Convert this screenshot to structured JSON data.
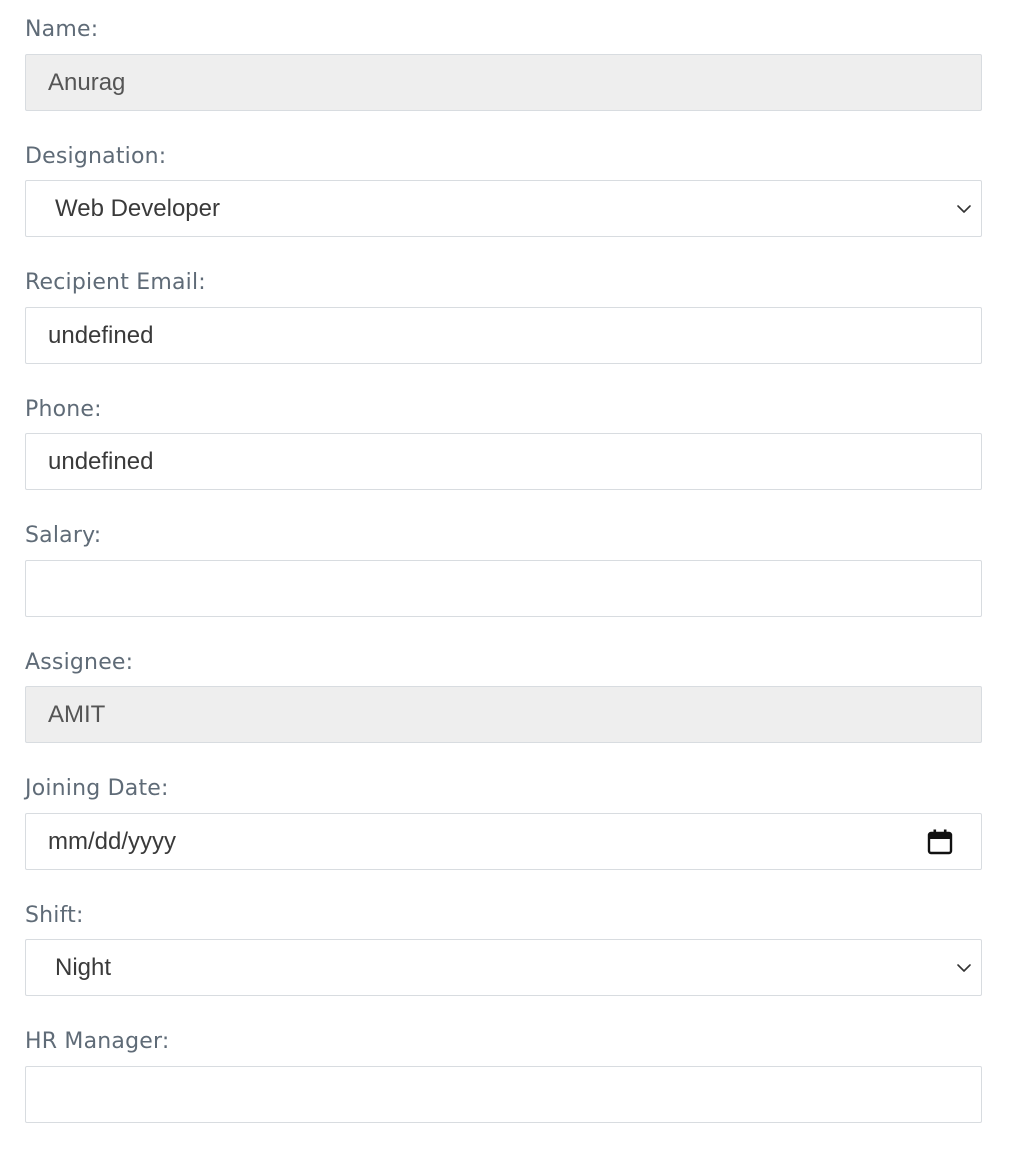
{
  "form": {
    "name": {
      "label": "Name:",
      "value": "Anurag"
    },
    "designation": {
      "label": "Designation:",
      "selected": "Web Developer"
    },
    "recipient_email": {
      "label": "Recipient Email:",
      "value": "undefined"
    },
    "phone": {
      "label": "Phone:",
      "value": "undefined"
    },
    "salary": {
      "label": "Salary:",
      "value": ""
    },
    "assignee": {
      "label": "Assignee:",
      "value": "AMIT"
    },
    "joining_date": {
      "label": "Joining Date:",
      "placeholder": "mm/dd/yyyy"
    },
    "shift": {
      "label": "Shift:",
      "selected": "Night"
    },
    "hr_manager": {
      "label": "HR Manager:",
      "value": ""
    }
  },
  "icons": {
    "select_arrow": "chevron-down-icon",
    "date_picker": "calendar-icon"
  }
}
